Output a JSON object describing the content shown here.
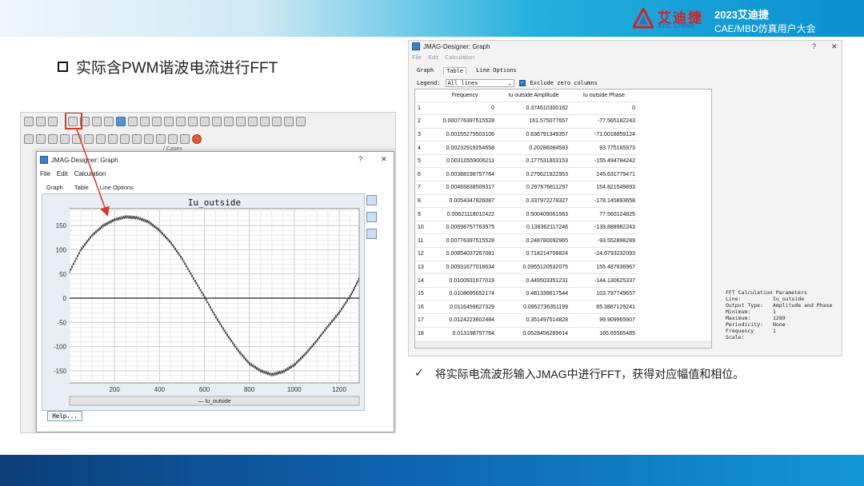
{
  "header": {
    "logo_cn": "艾迪捷",
    "logo_en": "ATIC CHINA",
    "conference_title": "2023艾迪捷",
    "conference_subtitle": "CAE/MBD仿真用户大会"
  },
  "slide_heading": "实际含PWM谐波电流进行FFT",
  "right_caption": {
    "check": "✓",
    "text": "将实际电流波形输入JMAG中进行FFT，获得对应幅值和相位。"
  },
  "left_window": {
    "title": "JMAG-Designer: Graph",
    "ctrl_help": "?",
    "ctrl_close": "✕",
    "menu": [
      "File",
      "Edit",
      "Calculation"
    ],
    "tabs": [
      "Graph",
      "Table",
      "Line Options"
    ],
    "help_button": "Help...",
    "cases_label": "/ Cases",
    "chart_data": {
      "type": "line",
      "title": "Iu_outside",
      "legend": "— Iu_outside",
      "xlim": [
        0,
        1289
      ],
      "ylim": [
        -175,
        185
      ],
      "xticks": [
        200,
        400,
        600,
        800,
        1000,
        1200
      ],
      "yticks": [
        150,
        100,
        50,
        0,
        -50,
        -100,
        -150
      ],
      "series": [
        {
          "name": "Iu_outside",
          "x": [
            0,
            50,
            100,
            150,
            200,
            250,
            300,
            350,
            400,
            450,
            500,
            550,
            600,
            650,
            700,
            750,
            800,
            850,
            900,
            950,
            1000,
            1050,
            1100,
            1150,
            1200,
            1250,
            1289
          ],
          "y": [
            55,
            100,
            130,
            150,
            162,
            168,
            166,
            158,
            140,
            115,
            82,
            42,
            3,
            -38,
            -75,
            -108,
            -135,
            -150,
            -158,
            -152,
            -138,
            -115,
            -88,
            -58,
            -30,
            5,
            40
          ]
        }
      ]
    }
  },
  "right_window": {
    "title": "JMAG-Designer: Graph",
    "ctrl_help": "?",
    "ctrl_close": "✕",
    "menu": [
      "File",
      "Edit",
      "Calculation"
    ],
    "tabs": [
      "Graph",
      "Table",
      "Line Options"
    ],
    "legend_label": "Legend:",
    "legend_value": "All lines",
    "exclude_label": "Exclude zero columns",
    "table": {
      "headers": [
        "",
        "Frequency",
        "Iu outside Amplitude",
        "Iu outside Phase"
      ],
      "rows": [
        [
          "1",
          "0",
          "0.374610300162",
          "0"
        ],
        [
          "2",
          "0.000776397515528",
          "161.575077657",
          "-77.565182243"
        ],
        [
          "3",
          "0.00155279503106",
          "0.636791349357",
          "-71.0018859124"
        ],
        [
          "4",
          "0.00232919254658",
          "0.20286084583",
          "93.775165973"
        ],
        [
          "5",
          "0.00310559006211",
          "0.177531803153",
          "-155.494784242"
        ],
        [
          "6",
          "0.00388198757764",
          "0.279621922953",
          "145.631779471"
        ],
        [
          "7",
          "0.00465838509317",
          "0.297676811297",
          "154.821549893"
        ],
        [
          "8",
          "0.0054347826087",
          "0.337972278327",
          "-178.145893658"
        ],
        [
          "9",
          "0.00621118012422",
          "0.500409061563",
          "77.560124825"
        ],
        [
          "10",
          "0.00698757763975",
          "0.138362117246",
          "-139.888982243"
        ],
        [
          "11",
          "0.00776397515528",
          "0.248780092965",
          "-93.552898289"
        ],
        [
          "12",
          "0.00854037267081",
          "0.718214708824",
          "-24.6793232093"
        ],
        [
          "13",
          "0.00931677018634",
          "0.0955120532075",
          "155.487636967"
        ],
        [
          "14",
          "0.0100931677019",
          "0.449503351231",
          "-144.130625337"
        ],
        [
          "15",
          "0.0108695652174",
          "0.481339617544",
          "103.797749657"
        ],
        [
          "16",
          "0.0116459627329",
          "0.0952736351199",
          "65.3887129241"
        ],
        [
          "17",
          "0.0124223602484",
          "0.351497514828",
          "99.909965907"
        ],
        [
          "18",
          "0.013198757764",
          "0.0528456289614",
          "165.65565485"
        ]
      ]
    },
    "params": {
      "heading": "FFT Calculation Parameters",
      "rows": [
        [
          "Line:",
          "Iu_outside"
        ],
        [
          "Output Type:",
          "Amplitude and Phase"
        ],
        [
          "Minimum:",
          "1"
        ],
        [
          "Maximum:",
          "1289"
        ],
        [
          "Periodicity:",
          "None"
        ],
        [
          "Frequency Scale:",
          "1"
        ]
      ]
    }
  }
}
